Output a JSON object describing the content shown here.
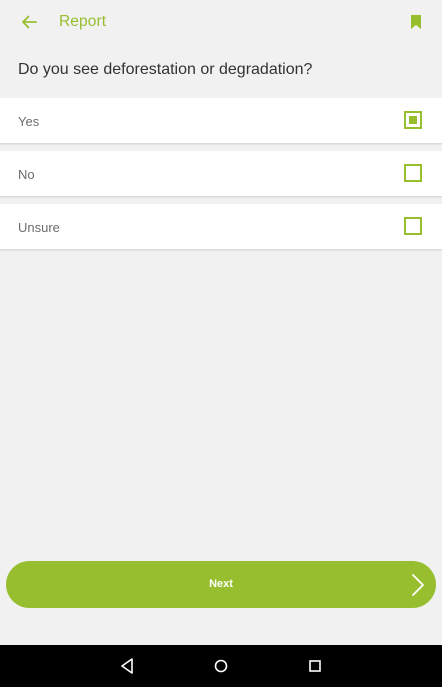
{
  "colors": {
    "accent": "#97be2f",
    "background": "#f1f1f1",
    "row_background": "#ffffff",
    "navbar": "#000000"
  },
  "appbar": {
    "title": "Report",
    "back_icon": "arrow-left-icon",
    "bookmark_icon": "bookmark-icon"
  },
  "question": "Do you see deforestation or degradation?",
  "options": [
    {
      "label": "Yes",
      "checked": true
    },
    {
      "label": "No",
      "checked": false
    },
    {
      "label": "Unsure",
      "checked": false
    }
  ],
  "next_button": {
    "label": "Next",
    "icon": "chevron-right-icon"
  },
  "system_nav": {
    "back_icon": "triangle-back-icon",
    "home_icon": "circle-home-icon",
    "recents_icon": "square-recents-icon"
  }
}
